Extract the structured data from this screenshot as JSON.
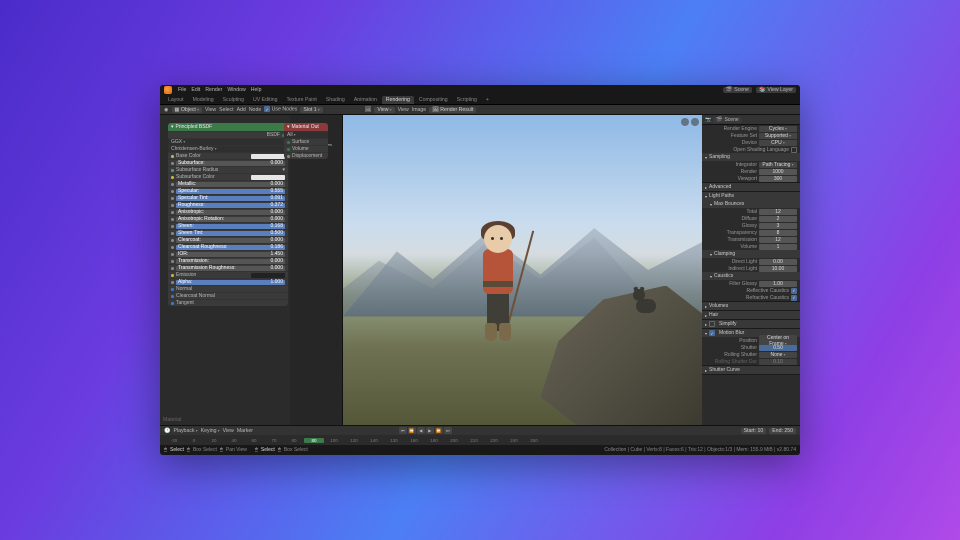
{
  "topmenu": {
    "file": "File",
    "edit": "Edit",
    "render": "Render",
    "window": "Window",
    "help": "Help"
  },
  "workspaces": {
    "layout": "Layout",
    "modeling": "Modeling",
    "sculpting": "Sculpting",
    "uv": "UV Editing",
    "tex": "Texture Paint",
    "shading": "Shading",
    "anim": "Animation",
    "rendering": "Rendering",
    "compositing": "Compositing",
    "scripting": "Scripting",
    "plus": "+"
  },
  "scene": {
    "label": "Scene",
    "viewlayer": "View Layer"
  },
  "toolbar": {
    "mode": "Object",
    "view": "View",
    "select": "Select",
    "add": "Add",
    "node": "Node",
    "usenodes": "Use Nodes",
    "slot": "Slot 1",
    "view2": "View",
    "view3": "View",
    "image": "Image",
    "renderresult": "Render Result"
  },
  "node_principled": {
    "title": "Principled BSDF",
    "bsdf": "BSDF",
    "ggx": "GGX",
    "burley": "Christensen-Burley",
    "rows": [
      {
        "dot": "yellow",
        "label": "Base Color",
        "swatch": true
      },
      {
        "dot": "grey",
        "slider": "gr",
        "label": "Subsurface:",
        "val": "0.000"
      },
      {
        "dot": "teal",
        "label": "Subsurface Radius",
        "expand": true
      },
      {
        "dot": "yellow",
        "label": "Subsurface Color",
        "swatch": true
      },
      {
        "dot": "grey",
        "slider": "gr",
        "label": "Metallic:",
        "val": "0.000"
      },
      {
        "dot": "grey",
        "slider": "blue",
        "label": "Specular:",
        "val": "0.555"
      },
      {
        "dot": "grey",
        "slider": "blue",
        "label": "Specular Tint:",
        "val": "0.091"
      },
      {
        "dot": "grey",
        "slider": "blue",
        "label": "Roughness:",
        "val": "0.372"
      },
      {
        "dot": "grey",
        "slider": "gr",
        "label": "Anisotropic:",
        "val": "0.000"
      },
      {
        "dot": "grey",
        "slider": "gr",
        "label": "Anisotropic Rotation:",
        "val": "0.000"
      },
      {
        "dot": "grey",
        "slider": "blue",
        "label": "Sheen:",
        "val": "0.168"
      },
      {
        "dot": "grey",
        "slider": "blue",
        "label": "Sheen Tint:",
        "val": "0.500"
      },
      {
        "dot": "grey",
        "slider": "gr",
        "label": "Clearcoat:",
        "val": "0.000"
      },
      {
        "dot": "grey",
        "slider": "blue",
        "label": "Clearcoat Roughness:",
        "val": "0.186"
      },
      {
        "dot": "grey",
        "slider": "gr",
        "label": "IOR:",
        "val": "1.450"
      },
      {
        "dot": "grey",
        "slider": "gr",
        "label": "Transmission:",
        "val": "0.000"
      },
      {
        "dot": "grey",
        "slider": "gr",
        "label": "Transmission Roughness:",
        "val": "0.000"
      },
      {
        "dot": "yellow",
        "label": "Emission",
        "swatch": "dark"
      },
      {
        "dot": "grey",
        "slider": "blue",
        "label": "Alpha:",
        "val": "1.000"
      },
      {
        "dot": "blue",
        "label": "Normal"
      },
      {
        "dot": "blue",
        "label": "Clearcoat Normal"
      },
      {
        "dot": "blue",
        "label": "Tangent"
      }
    ]
  },
  "material_label": "Material",
  "node_matout": {
    "title": "Material Out",
    "all": "All",
    "surface": "Surface",
    "volume": "Volume",
    "disp": "Displacement"
  },
  "props": {
    "header": "Scene",
    "engine_l": "Render Engine",
    "engine": "Cycles",
    "feat_l": "Feature Set",
    "feat": "Supported",
    "device_l": "Device",
    "device": "CPU",
    "osl": "Open Shading Language",
    "sampling": "Sampling",
    "integrator_l": "Integrator",
    "integrator": "Path Tracing",
    "render_l": "Render",
    "render": "1000",
    "viewport_l": "Viewport",
    "viewport": "300",
    "advanced": "Advanced",
    "lightpaths": "Light Paths",
    "maxbounces": "Max Bounces",
    "total_l": "Total",
    "total": "12",
    "diffuse_l": "Diffuse",
    "diffuse": "2",
    "glossy_l": "Glossy",
    "glossy": "3",
    "transp_l": "Transparency",
    "transp": "8",
    "transm_l": "Transmission",
    "transm": "12",
    "volume_l": "Volume",
    "volume": "1",
    "clamping": "Clamping",
    "direct_l": "Direct Light",
    "direct": "0.00",
    "indirect_l": "Indirect Light",
    "indirect": "10.00",
    "caustics": "Caustics",
    "filterg_l": "Filter Glossy",
    "filterg": "1.00",
    "reflcaust": "Reflective Caustics",
    "refrcaust": "Refractive Caustics",
    "volumes": "Volumes",
    "hair": "Hair",
    "simplify": "Simplify",
    "motionblur": "Motion Blur",
    "position_l": "Position",
    "position": "Center on Frame",
    "shutter_l": "Shutter",
    "shutter": "0.50",
    "rolling_l": "Rolling Shutter",
    "rolling": "None",
    "rollingdur_l": "Rolling Shutter Dur",
    "rollingdur": "0.10",
    "shuttercurve": "Shutter Curve"
  },
  "timeline": {
    "playback": "Playback",
    "keying": "Keying",
    "view": "View",
    "marker": "Marker",
    "frames": [
      "-20",
      "0",
      "20",
      "40",
      "60",
      "70",
      "80",
      "80",
      "100",
      "120",
      "140",
      "130",
      "160",
      "180",
      "200",
      "210",
      "220",
      "240",
      "250"
    ],
    "current_idx": 7,
    "start_l": "Start:",
    "start": "10",
    "end_l": "End:",
    "end": "250"
  },
  "status": {
    "select": "Select",
    "box": "Box Select",
    "pan": "Pan View",
    "right": "Collection | Cube | Verts:8 | Faces:6 | Tris:12 | Objects:1/3 | Mem: 155.9 MiB | v2.80.74"
  }
}
